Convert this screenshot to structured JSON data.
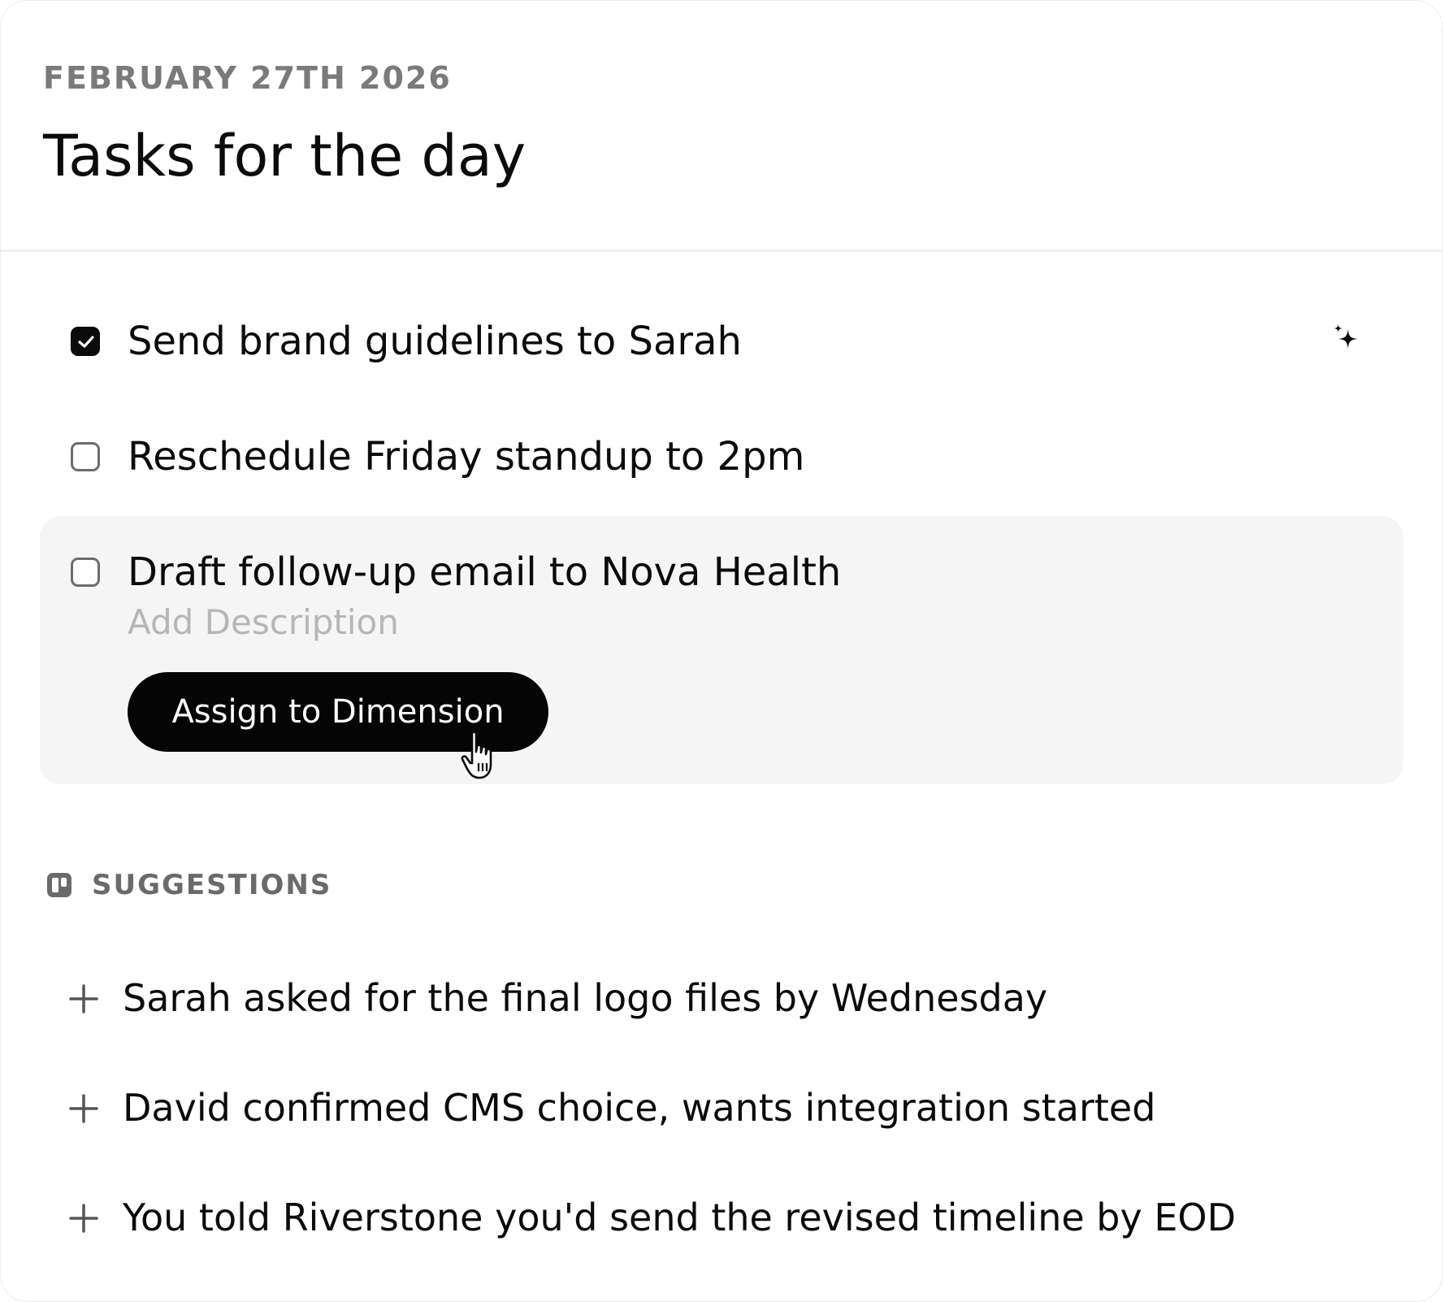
{
  "header": {
    "date": "FEBRUARY 27TH 2026",
    "title": "Tasks for the day"
  },
  "tasks": [
    {
      "label": "Send brand guidelines to Sarah",
      "checked": true
    },
    {
      "label": "Reschedule Friday standup to 2pm",
      "checked": false
    },
    {
      "label": "Draft follow-up email to Nova Health",
      "checked": false,
      "description_placeholder": "Add Description",
      "action_label": "Assign to Dimension"
    }
  ],
  "suggestions": {
    "title": "SUGGESTIONS",
    "items": [
      {
        "label": "Sarah asked for the final logo files by Wednesday"
      },
      {
        "label": "David confirmed CMS choice, wants integration started"
      },
      {
        "label": "You told Riverstone you'd send the revised timeline by EOD"
      }
    ]
  },
  "icons": {
    "checkbox_checked": "check-icon",
    "ai_action": "sparkle-icon",
    "suggestions": "trello-board-icon",
    "add": "plus-icon",
    "pointer": "hand-cursor-icon"
  },
  "colors": {
    "text": "#0b0b0b",
    "muted": "#7a7a7a",
    "placeholder": "#b6b6b6",
    "active_row_bg": "#f5f5f5",
    "button_bg": "#050505"
  }
}
